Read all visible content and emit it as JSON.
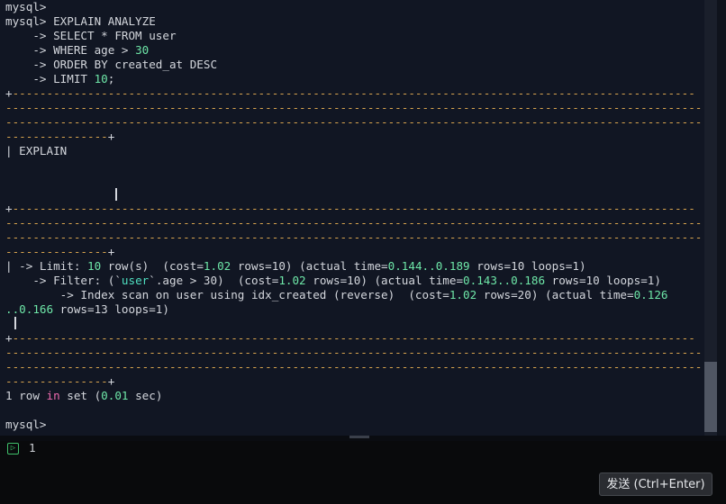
{
  "terminal": {
    "query": [
      "mysql>",
      "mysql> EXPLAIN ANALYZE",
      "    -> SELECT * FROM user",
      "    -> WHERE age > 30",
      "    -> ORDER BY created_at DESC",
      "    -> LIMIT 10;"
    ],
    "separator_full": "+-----------------------------------------------------------------------------------------------",
    "separator_end": "---------------+",
    "explain_header": "| EXPLAIN",
    "plan": {
      "limit": {
        "prefix": "| -> Limit: ",
        "n": "10",
        "mid1": " row(s)  (cost=",
        "cost": "1.02",
        "mid2": " rows=10) (actual time=",
        "time": "0.144..0.189",
        "mid3": " rows=10 loops=1)"
      },
      "filter": {
        "prefix": "    -> Filter: (`",
        "table": "user",
        "mid1": "`.age > 30)  (cost=",
        "cost": "1.02",
        "mid2": " rows=10) (actual time=",
        "time": "0.143..0.186",
        "mid3": " rows=10 loops=1)"
      },
      "index": {
        "text": "        -> Index scan on user using idx_created (reverse)  (cost=",
        "cost": "1.02",
        "mid": " rows=20) (actual time=",
        "time": "0.126",
        "cont_time": "..0.166",
        "cont_rest": " rows=13 loops=1)"
      }
    },
    "result": {
      "prefix": "1 row ",
      "kw": "in",
      "mid": " set (",
      "secs": "0.01",
      "suffix": " sec)"
    },
    "final_prompt": "mysql>"
  },
  "input": {
    "line_number": "1",
    "prompt_glyph": "▷"
  },
  "send_button": {
    "label": "发送 (Ctrl+Enter)"
  }
}
